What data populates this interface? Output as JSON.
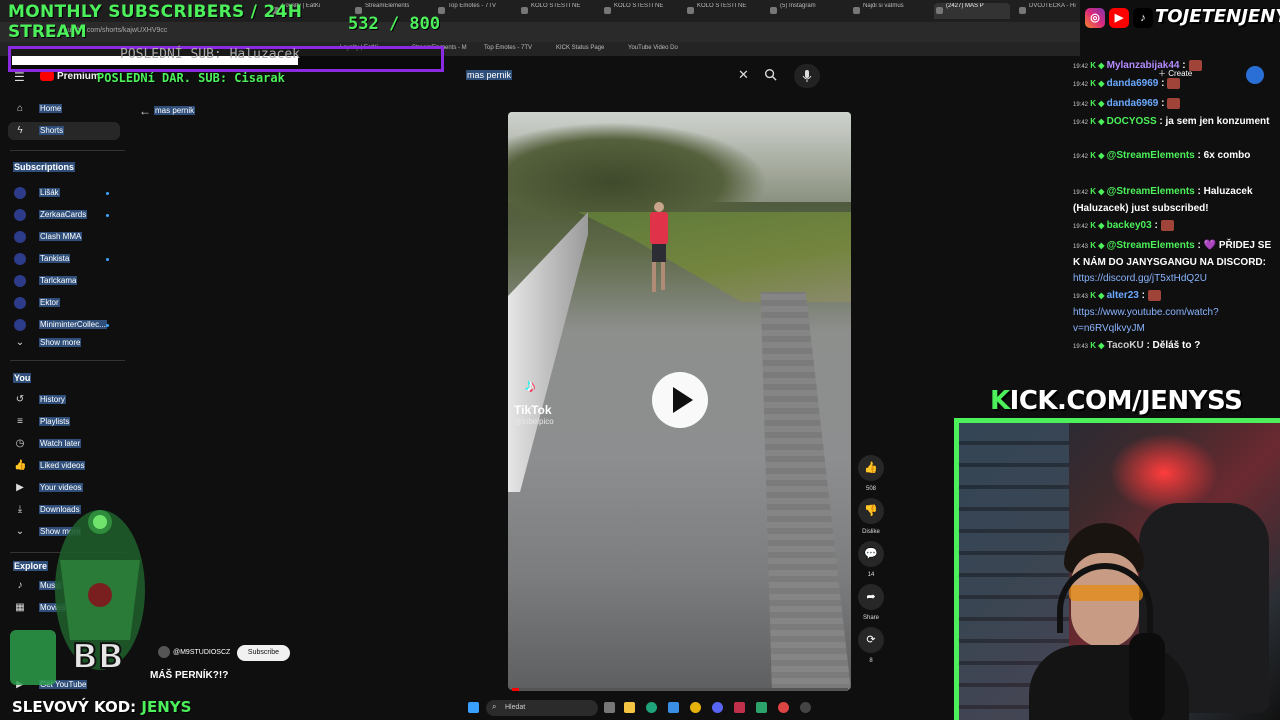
{
  "overlay": {
    "title_line1": "MONTHLY SUBSCRIBERS / 24H",
    "title_line2": "STREAM",
    "sub_counter": "532  / 800",
    "last_sub": "POSLEDNÍ SUB: Haluzacek",
    "last_donation": "POSLEDNí DAR. SUB: Cisarak",
    "social_handle": "TOJETENJENYS",
    "kick_banner_k": "K",
    "kick_banner_rest": "ICK.COM/JENYSS",
    "discount_label": "SLEVOVÝ KOD: ",
    "discount_code": "JENYS"
  },
  "browser": {
    "tabs": [
      "Loyalty | EatKi",
      "StreamElements",
      "Top Emotes - 7TV",
      "KOLO ŠTĚSTÍ NE",
      "KOLO ŠTĚSTÍ NE",
      "KOLO ŠTĚSTÍ NE",
      "(5) Instagram",
      "Najdi si vatmus",
      "(2427) MÁŠ P",
      "DVOJTECKA - Hi"
    ],
    "url": "youtube.com/shorts/kajwUXHV9cc",
    "bookmarks": [
      "Loyalty | EatKi",
      "StreamElements - M",
      "Top Emotes - 7TV",
      "KICK Status Page",
      "YouTube Video Do"
    ]
  },
  "youtube": {
    "brand_label": "Premium",
    "search_value": "mas pernik",
    "create_label": "Create",
    "sidebar": {
      "main_items": [
        {
          "label": "Home",
          "icon": "home-icon"
        },
        {
          "label": "Shorts",
          "icon": "shorts-icon"
        }
      ],
      "subscriptions_heading": "Subscriptions",
      "subscriptions": [
        "Lišák",
        "ZerkaaCards",
        "Clash MMA",
        "Tankista",
        "Tarlckama",
        "Ektor",
        "MiniminterCollec..."
      ],
      "show_more": "Show more",
      "you_heading": "You",
      "you_items": [
        "History",
        "Playlists",
        "Watch later",
        "Liked videos",
        "Your videos",
        "Downloads",
        "Show more"
      ],
      "explore_heading": "Explore",
      "explore_items": [
        "Music",
        "Movies"
      ],
      "footer_item": "Get YouTube"
    },
    "back_label": "mas pernik",
    "video": {
      "tiktok_brand": "TikTok",
      "tiktok_handle": "@lobelpico",
      "progress": 0.02,
      "channel": "@M9STUDIOSCZ",
      "subscribe_label": "Subscribe",
      "title": "MÁŠ PERNÍK?!?"
    },
    "actions": [
      {
        "icon": "like-icon",
        "glyph": "👍",
        "label": "508"
      },
      {
        "icon": "dislike-icon",
        "glyph": "👎",
        "label": "Dislike"
      },
      {
        "icon": "comments-icon",
        "glyph": "💬",
        "label": "14"
      },
      {
        "icon": "share-icon",
        "glyph": "➦",
        "label": "Share"
      },
      {
        "icon": "remix-icon",
        "glyph": "⟳",
        "label": "8"
      }
    ]
  },
  "chat": [
    {
      "time": "19:42",
      "user": "Mylanzabijak44",
      "user_color": "#b48cff",
      "message": ":"
    },
    {
      "time": "19:42",
      "user": "danda6969",
      "user_color": "#6aa9ff",
      "message": ":"
    },
    {
      "time": "19:42",
      "user": "danda6969",
      "user_color": "#6aa9ff",
      "message": ":"
    },
    {
      "time": "19:42",
      "user": "DOCYOSS",
      "user_color": "#4cf05a",
      "message": ": ja sem jen konzument"
    },
    {
      "time": "19:42",
      "user": "@StreamElements",
      "user_color": "#4cf05a",
      "message": ": 6x combo"
    },
    {
      "time": "19:42",
      "user": "@StreamElements",
      "user_color": "#4cf05a",
      "message": ": Haluzacek (Haluzacek) just subscribed!"
    },
    {
      "time": "19:42",
      "user": "backey03",
      "user_color": "#4cf05a",
      "message": ":"
    },
    {
      "time": "19:43",
      "user": "@StreamElements",
      "user_color": "#4cf05a",
      "message": ": 💜 PŘIDEJ SE K NÁM DO JANYSGANGU NA DISCORD:",
      "link": "https://discord.gg/jT5xtHdQ2U"
    },
    {
      "time": "19:43",
      "user": "alter23",
      "user_color": "#6aa9ff",
      "message": ":",
      "link": "https://www.youtube.com/watch?v=n6RVqlkvyJM"
    },
    {
      "time": "19:43",
      "user": "TacoKU",
      "user_color": "#ccc",
      "message": ": Děláš to ?"
    }
  ],
  "taskbar": {
    "search_placeholder": "Hledat"
  },
  "colors": {
    "overlay_green": "#4cf05a",
    "overlay_purple": "#8a2be2",
    "youtube_red": "#ff0000",
    "selection_blue": "#2f4f7a"
  }
}
